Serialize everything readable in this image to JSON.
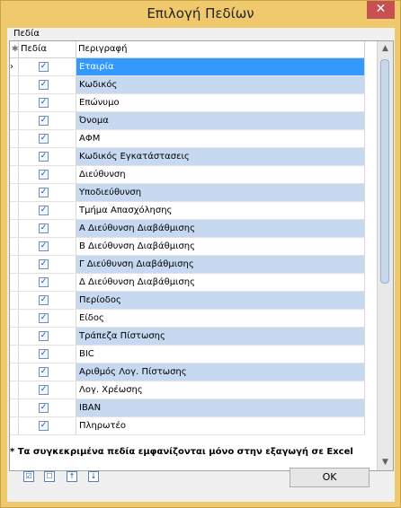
{
  "window": {
    "title": "Επιλογή Πεδίων",
    "close_glyph": "✕"
  },
  "group_label": "Πεδία",
  "grid": {
    "columns": [
      "Πεδία",
      "Περιγραφή"
    ],
    "rows": [
      {
        "desc": "Εταιρία",
        "checked": true,
        "selected": true
      },
      {
        "desc": "Κωδικός",
        "checked": true
      },
      {
        "desc": "Επώνυμο",
        "checked": true
      },
      {
        "desc": "Όνομα",
        "checked": true
      },
      {
        "desc": "ΑΦΜ",
        "checked": true
      },
      {
        "desc": "Κωδικός Εγκατάστασεις",
        "checked": true
      },
      {
        "desc": "Διεύθυνση",
        "checked": true
      },
      {
        "desc": "Υποδιεύθυνση",
        "checked": true
      },
      {
        "desc": "Τμήμα Απασχόλησης",
        "checked": true
      },
      {
        "desc": "Α Διεύθυνση Διαβάθμισης",
        "checked": true
      },
      {
        "desc": "Β Διεύθυνση Διαβάθμισης",
        "checked": true
      },
      {
        "desc": "Γ Διεύθυνση Διαβάθμισης",
        "checked": true
      },
      {
        "desc": "Δ Διεύθυνση Διαβάθμισης",
        "checked": true
      },
      {
        "desc": "Περίοδος",
        "checked": true
      },
      {
        "desc": "Είδος",
        "checked": true
      },
      {
        "desc": "Τράπεζα Πίστωσης",
        "checked": true
      },
      {
        "desc": "BIC",
        "checked": true
      },
      {
        "desc": "Αριθμός Λογ. Πίστωσης",
        "checked": true
      },
      {
        "desc": "Λογ. Χρέωσης",
        "checked": true
      },
      {
        "desc": "IBAN",
        "checked": true
      },
      {
        "desc": "Πληρωτέο",
        "checked": true
      }
    ]
  },
  "note": "* Τα συγκεκριμένα πεδία εμφανίζονται μόνο στην εξαγωγή σε Excel",
  "toolbar_icons": [
    "select-all-icon",
    "deselect-all-icon",
    "move-up-icon",
    "move-down-icon"
  ],
  "ok_label": "OK",
  "colors": {
    "title_bar": "#f0c96d",
    "row_alt": "#c6d9f1",
    "row_selected": "#3399ff"
  }
}
